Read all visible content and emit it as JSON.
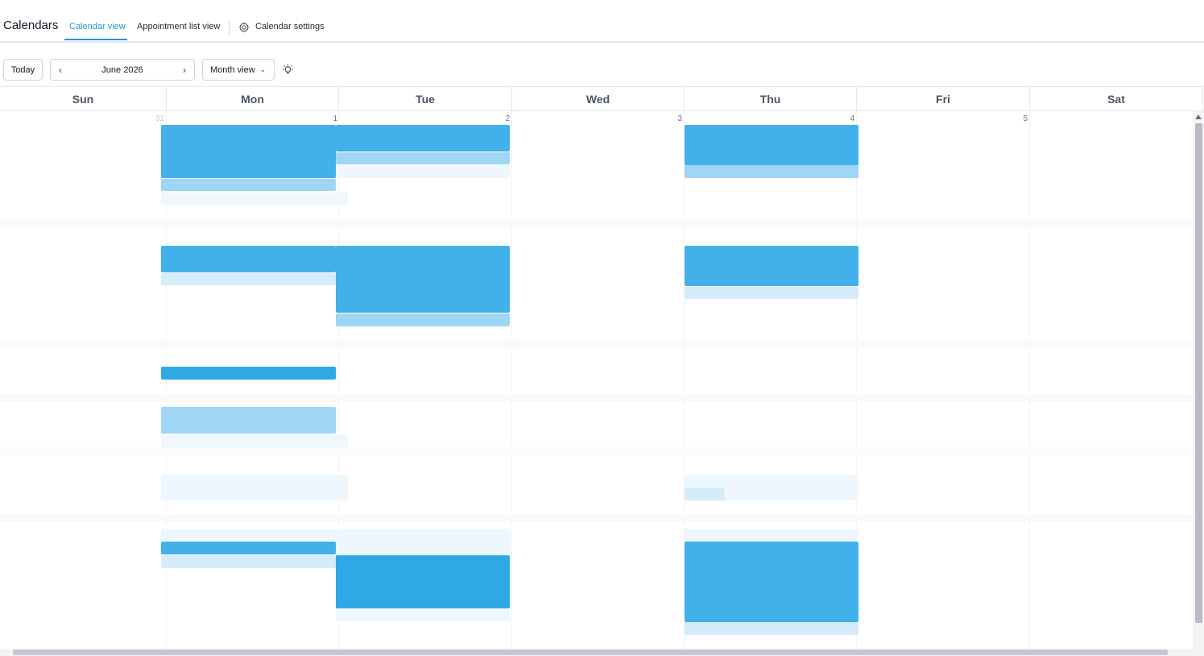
{
  "header": {
    "app_title": "Calendars",
    "tabs": [
      {
        "label": "Calendar view",
        "active": true
      },
      {
        "label": "Appointment list view",
        "active": false
      }
    ],
    "settings_label": "Calendar settings"
  },
  "toolbar": {
    "today_label": "Today",
    "prev_label": "‹",
    "next_label": "›",
    "current_period": "June 2026",
    "view_select": "Month view",
    "theme_icon": "lightbulb-icon"
  },
  "calendar": {
    "days_of_week": [
      "Sun",
      "Mon",
      "Tue",
      "Wed",
      "Thu",
      "Fri",
      "Sat"
    ],
    "day_numbers": [
      "31",
      "1",
      "2",
      "3",
      "4",
      "5"
    ]
  },
  "colors": {
    "accent": "#1b9ad6",
    "event_dark": "#2fa9e6",
    "event_light": "#9fd6f3"
  }
}
